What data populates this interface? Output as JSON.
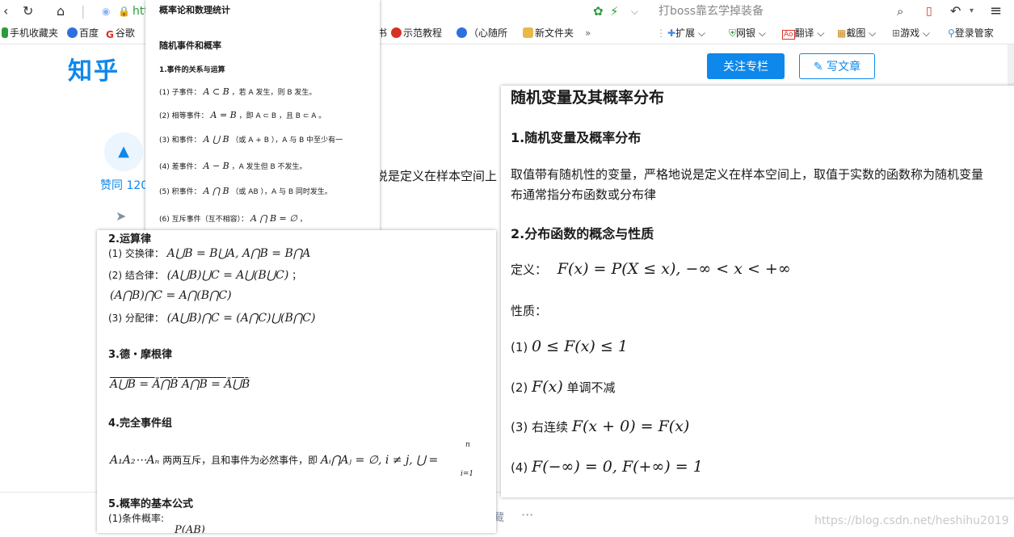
{
  "browser": {
    "url_partial": "htt",
    "search_text": "打boss靠玄学掉装备",
    "bookmarks": [
      {
        "label": "手机收藏夹",
        "icon": "phone-icon",
        "color": "#2a9d3a"
      },
      {
        "label": "百度",
        "icon": "baidu-paw-icon",
        "color": "#2f6fde"
      },
      {
        "label": "谷歌",
        "icon": "google-icon",
        "color": "#d93025"
      },
      {
        "label": "示范教程",
        "icon": "play-circle-icon",
        "color": "#d93025"
      },
      {
        "label": "（心随所",
        "icon": "play-circle-icon",
        "color": "#2f6fde"
      },
      {
        "label": "新文件夹",
        "icon": "folder-icon",
        "color": "#e8b84a"
      }
    ],
    "bookmark_more": "»",
    "tools": [
      {
        "label": "扩展",
        "icon": "puzzle-icon"
      },
      {
        "label": "网银",
        "icon": "shield-icon"
      },
      {
        "label": "翻译",
        "icon": "translate-icon"
      },
      {
        "label": "截图",
        "icon": "screenshot-icon"
      },
      {
        "label": "游戏",
        "icon": "gamepad-icon"
      },
      {
        "label": "登录管家",
        "icon": "key-icon"
      }
    ]
  },
  "zhihu": {
    "logo": "知乎",
    "follow_label": "关注专栏",
    "write_label": "写文章",
    "vote_count": "赞同 120",
    "bg_text": "说是定义在样本空间上"
  },
  "panel1": {
    "title": "概率论和数理统计",
    "section": "随机事件和概率",
    "sub": "1.事件的关系与运算",
    "items": [
      {
        "label": "(1) 子事件：",
        "math": "A ⊂ B",
        "rest": "，若 A 发生，则 B 发生。"
      },
      {
        "label": "(2) 相等事件：",
        "math": "A = B",
        "rest": "，即 A ⊂ B ，且 B ⊂ A 。"
      },
      {
        "label": "(3) 和事件：",
        "math": "A ⋃ B",
        "rest": "（或 A + B ），A 与 B 中至少有一"
      },
      {
        "label": "(4) 差事件：",
        "math": "A − B",
        "rest": "，A 发生但 B 不发生。"
      },
      {
        "label": "(5) 积事件：",
        "math": "A ⋂ B",
        "rest": "（或 AB ），A 与 B 同时发生。"
      },
      {
        "label": "(6) 互斥事件（互不相容）：",
        "math": "A ⋂ B = ∅",
        "rest": "，"
      }
    ]
  },
  "panel2": {
    "h1": "2.运算律",
    "laws": [
      {
        "label": "(1) 交换律：",
        "math": "A⋃B = B⋃A, A⋂B = B⋂A"
      },
      {
        "label": "(2) 结合律：",
        "math": "(A⋃B)⋃C = A⋃(B⋃C)",
        "tail": "；"
      },
      {
        "label": "",
        "math": "(A⋂B)⋂C = A⋂(B⋂C)"
      },
      {
        "label": "(3) 分配律：",
        "math": "(A⋃B)⋂C = (A⋂C)⋃(B⋂C)"
      }
    ],
    "h2": "3.德・摩根律",
    "demorgan": "A⋃B = Ā⋂B̄    A⋂B = Ā⋃B̄",
    "h3": "4.完全事件组",
    "complete_math1": "A₁A₂⋯Aₙ",
    "complete_text": "两两互斥，且和事件为必然事件，即",
    "complete_math2": "Aᵢ⋂Aⱼ = ∅, i ≠ j, ⋃",
    "complete_top": "n",
    "complete_bottom": "i=1",
    "complete_eq": "=",
    "h4": "5.概率的基本公式",
    "cond": "(1)条件概率:",
    "cond_math": "P(AB)"
  },
  "panel3": {
    "title": "随机变量及其概率分布",
    "s1": "1.随机变量及概率分布",
    "p1": "取值带有随机性的变量，严格地说是定义在样本空间上，取值于实数的函数称为随机变量",
    "p2": "布通常指分布函数或分布律",
    "s2": "2.分布函数的概念与性质",
    "def_label": "定义：",
    "def_math": "F(x) = P(X ≤ x), −∞ < x < +∞",
    "prop_label": "性质：",
    "props": [
      {
        "label": "(1)",
        "math": "0 ≤ F(x) ≤ 1",
        "tail": ""
      },
      {
        "label": "(2)",
        "math": "F(x)",
        "tail": "单调不减"
      },
      {
        "label": "(3) 右连续",
        "math": "F(x + 0) = F(x)",
        "tail": ""
      },
      {
        "label": "(4)",
        "math": "F(−∞) = 0, F(+∞) = 1",
        "tail": ""
      }
    ]
  },
  "footer": {
    "watermark": "https://blog.csdn.net/heshihu2019",
    "dots": "···",
    "frag": "藏"
  }
}
